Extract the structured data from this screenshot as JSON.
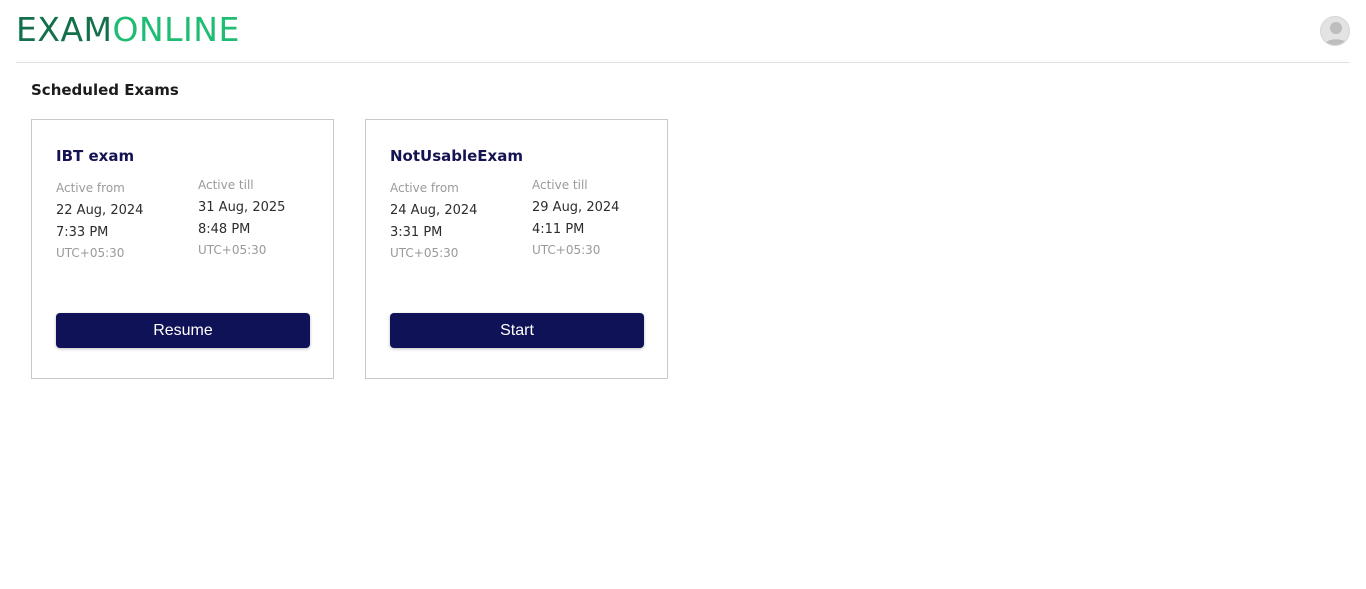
{
  "header": {
    "logo_part1": "EXAM",
    "logo_part2": "ONLINE",
    "avatar_icon": "user-avatar-icon"
  },
  "section_title": "Scheduled Exams",
  "exams": [
    {
      "title": "IBT exam",
      "from_label": "Active from",
      "from_date": "22 Aug, 2024",
      "from_time": "7:33 PM",
      "from_tz": "UTC+05:30",
      "till_label": "Active till",
      "till_date": "31 Aug, 2025",
      "till_time": "8:48 PM",
      "till_tz": "UTC+05:30",
      "button_label": "Resume"
    },
    {
      "title": "NotUsableExam",
      "from_label": "Active from",
      "from_date": "24 Aug, 2024",
      "from_time": "3:31 PM",
      "from_tz": "UTC+05:30",
      "till_label": "Active till",
      "till_date": "29 Aug, 2024",
      "till_time": "4:11 PM",
      "till_tz": "UTC+05:30",
      "button_label": "Start"
    }
  ],
  "colors": {
    "logo_dark": "#13704a",
    "logo_light": "#1fbd74",
    "button_bg": "#0f1257",
    "card_title": "#141452"
  }
}
